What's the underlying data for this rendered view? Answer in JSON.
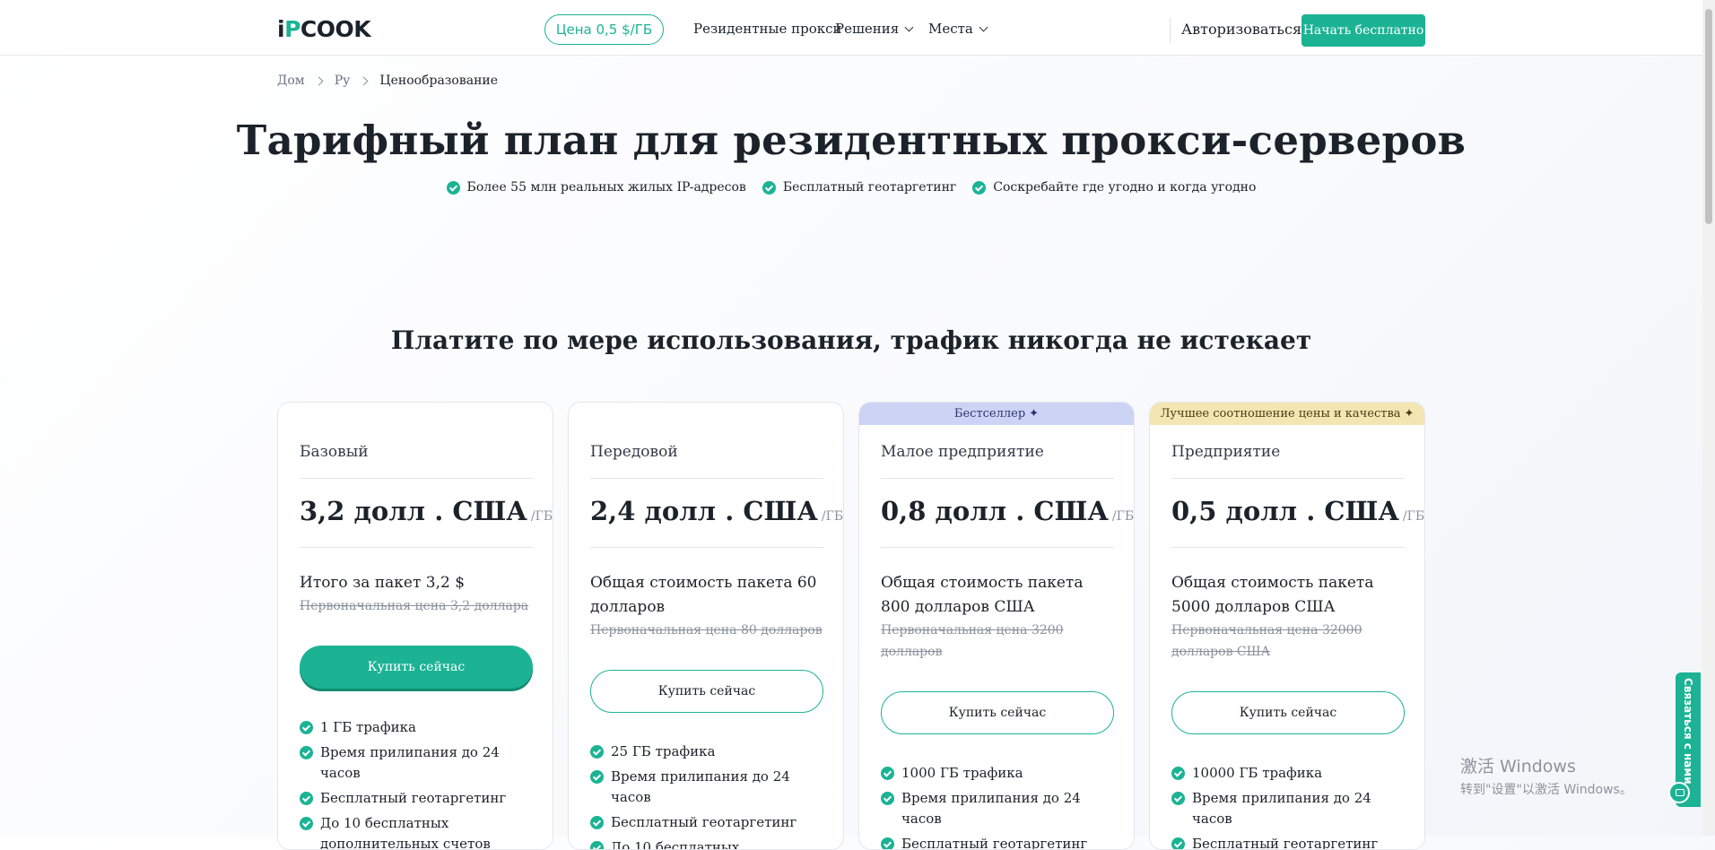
{
  "header": {
    "logo_prefix": "i",
    "logo_dot": "P",
    "logo_suffix": "COOK",
    "price_pill": "Цена 0,5 $/ГБ",
    "nav": {
      "residential": "Резидентные прокси",
      "solutions": "Решения",
      "locations": "Места"
    },
    "login": "Авторизоваться",
    "start": "Начать бесплатно"
  },
  "breadcrumb": {
    "home": "Дом",
    "lang": "Ру",
    "current": "Ценообразование"
  },
  "hero": {
    "title": "Тарифный план для резидентных прокси-серверов",
    "features": [
      "Более 55 млн реальных жилых IP-адресов",
      "Бесплатный геотаргетинг",
      "Соскребайте где угодно и когда угодно"
    ]
  },
  "section_title": "Платите по мере использования, трафик никогда не истекает",
  "plans": [
    {
      "badge": "",
      "name": "Базовый",
      "price": "3,2 долл . США",
      "unit": "/ГБ",
      "total": "Итого за пакет 3,2 $",
      "original": "Первоначальная цена 3,2 доллара",
      "button": "Купить сейчас",
      "features": [
        "1 ГБ трафика",
        "Время прилипания до 24 часов",
        "Бесплатный геотаргетинг",
        "До 10 бесплатных дополнительных счетов"
      ]
    },
    {
      "badge": "",
      "name": "Передовой",
      "price": "2,4 долл . США",
      "unit": "/ГБ",
      "total": "Общая стоимость пакета 60 долларов",
      "original": "Первоначальная цена 80 долларов",
      "button": "Купить сейчас",
      "features": [
        "25 ГБ трафика",
        "Время прилипания до 24 часов",
        "Бесплатный геотаргетинг",
        "До 10 бесплатных"
      ]
    },
    {
      "badge": "Бестселлер",
      "name": "Малое предприятие",
      "price": "0,8 долл . США",
      "unit": "/ГБ",
      "total": "Общая стоимость пакета 800 долларов США",
      "original": "Первоначальная цена 3200 долларов",
      "button": "Купить сейчас",
      "features": [
        "1000 ГБ трафика",
        "Время прилипания до 24 часов",
        "Бесплатный геотаргетинг"
      ]
    },
    {
      "badge": "Лучшее соотношение цены и качества",
      "name": "Предприятие",
      "price": "0,5 долл . США",
      "unit": "/ГБ",
      "total": "Общая стоимость пакета 5000 долларов США",
      "original": "Первоначальная цена 32000 долларов США",
      "button": "Купить сейчас",
      "features": [
        "10000 ГБ трафика",
        "Время прилипания до 24 часов",
        "Бесплатный геотаргетинг"
      ]
    }
  ],
  "widgets": {
    "contact": "Связаться с нами",
    "watermark_title": "激活 Windows",
    "watermark_sub": "转到\"设置\"以激活 Windows。"
  },
  "colors": {
    "accent": "#1bb394",
    "badge_blue": "#cdd3f5",
    "badge_yellow": "#f3e6b3"
  }
}
